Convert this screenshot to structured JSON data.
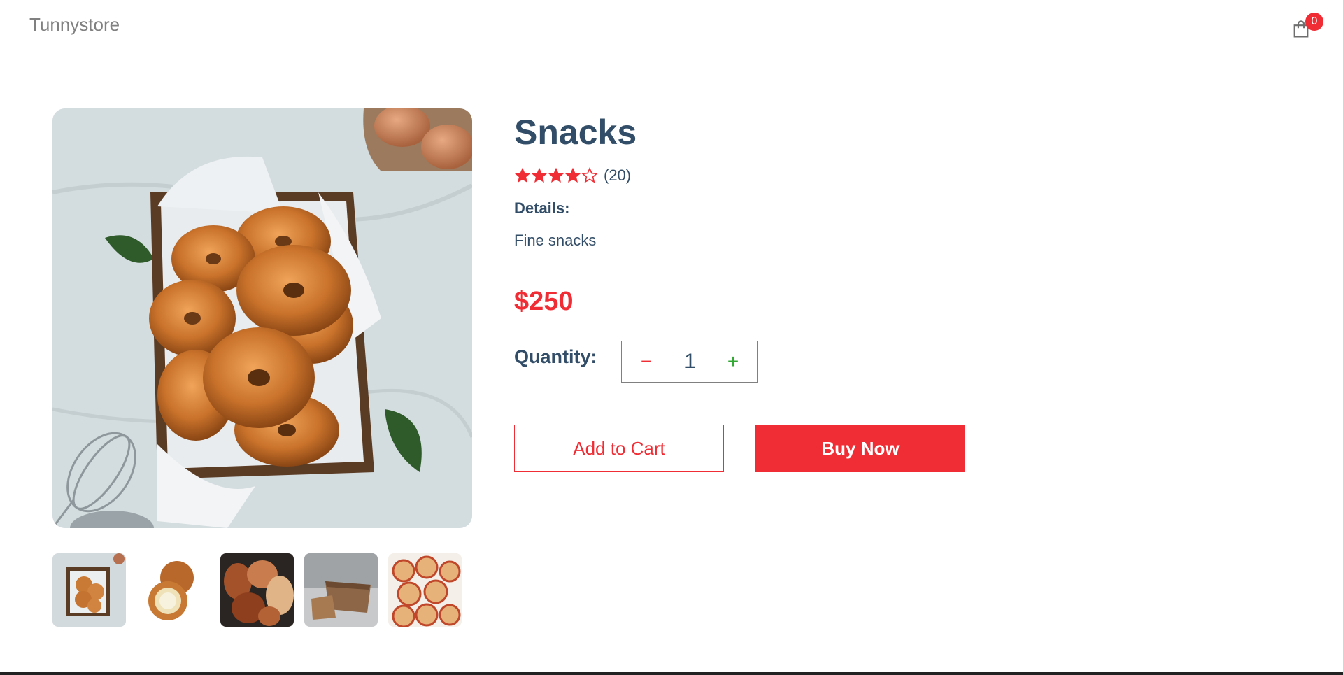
{
  "navbar": {
    "logo": "Tunnystore",
    "cart_count": "0"
  },
  "product": {
    "title": "Snacks",
    "rating_stars": 4,
    "rating_max": 5,
    "review_count": "(20)",
    "details_label": "Details:",
    "details_text": "Fine snacks",
    "price": "$250"
  },
  "quantity": {
    "label": "Quantity:",
    "minus": "−",
    "value": "1",
    "plus": "+"
  },
  "actions": {
    "add_to_cart": "Add to Cart",
    "buy_now": "Buy Now"
  },
  "colors": {
    "accent": "#f02d34",
    "text": "#324d67",
    "plus": "#31a831"
  }
}
